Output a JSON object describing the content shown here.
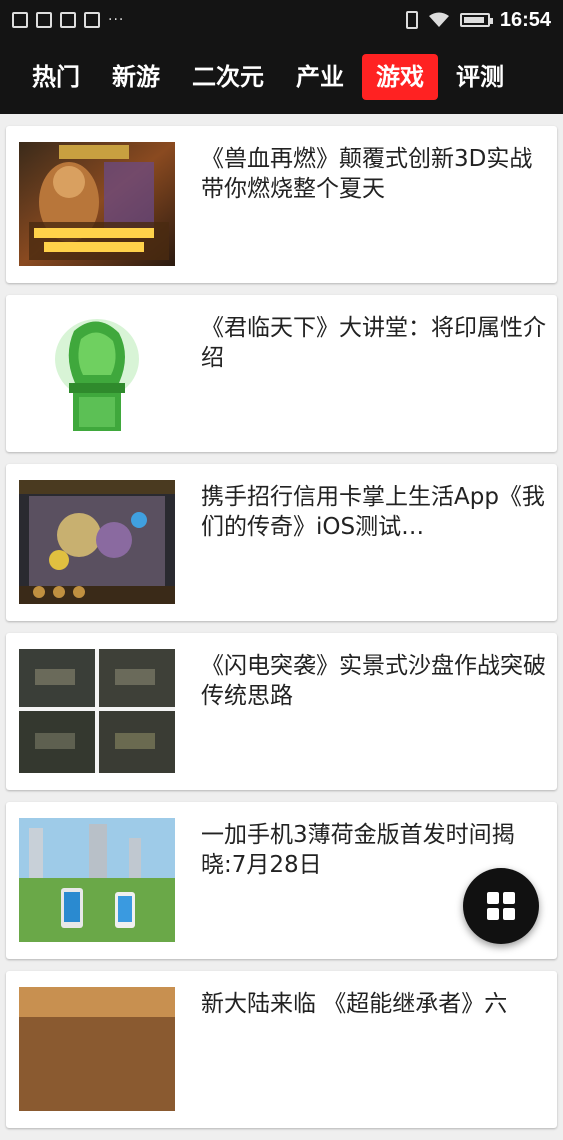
{
  "status_bar": {
    "time": "16:54",
    "left_icons": [
      "image-icon",
      "download-icon",
      "package-icon",
      "package-icon"
    ],
    "more": "···",
    "battery_level": 0.9
  },
  "tabs": [
    {
      "label": "热门",
      "active": false
    },
    {
      "label": "新游",
      "active": false
    },
    {
      "label": "二次元",
      "active": false
    },
    {
      "label": "产业",
      "active": false
    },
    {
      "label": "游戏",
      "active": true
    },
    {
      "label": "评测",
      "active": false
    }
  ],
  "articles": [
    {
      "title": "《兽血再燃》颠覆式创新3D实战 带你燃烧整个夏天",
      "thumb": "game-art-thumbnail"
    },
    {
      "title": "《君临天下》大讲堂：将印属性介绍",
      "thumb": "jade-seal-thumbnail"
    },
    {
      "title": "携手招行信用卡掌上生活App《我们的传奇》iOS测试…",
      "thumb": "game-battle-thumbnail"
    },
    {
      "title": "《闪电突袭》实景式沙盘作战突破传统思路",
      "thumb": "tank-grid-thumbnail"
    },
    {
      "title": "一加手机3薄荷金版首发时间揭晓:7月28日",
      "thumb": "phones-outdoor-thumbnail"
    },
    {
      "title": "新大陆来临 《超能继承者》六",
      "thumb": "partial-thumbnail"
    }
  ],
  "fab": {
    "icon": "grid-icon"
  }
}
